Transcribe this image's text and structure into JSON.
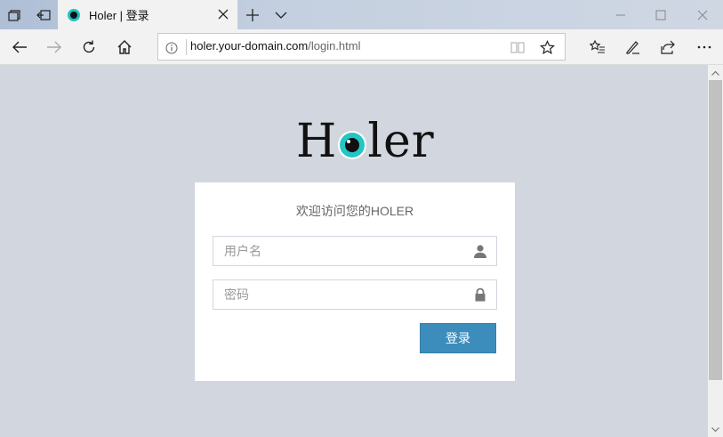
{
  "tab": {
    "title": "Holer | 登录"
  },
  "address": {
    "host": "holer.your-domain.com",
    "path": "/login.html"
  },
  "logo": {
    "left": "H",
    "right": "ler"
  },
  "login": {
    "message": "欢迎访问您的HOLER",
    "username_placeholder": "用户名",
    "password_placeholder": "密码",
    "submit_label": "登录"
  },
  "colors": {
    "background": "#d2d6de",
    "button": "#3c8dbc",
    "logo_accent": "#23c6c2"
  },
  "icons": {
    "tab_actions": "tabs-aside-icon",
    "set_aside": "set-aside-icon",
    "back": "back-arrow-icon",
    "forward": "forward-arrow-icon",
    "refresh": "refresh-icon",
    "home": "home-icon",
    "info": "info-icon",
    "reading_view": "reading-view-icon",
    "favorite": "star-icon",
    "favorites_hub": "favorites-list-icon",
    "notes": "pen-icon",
    "share": "share-icon",
    "more": "more-icon",
    "user": "user-icon",
    "lock": "lock-icon"
  }
}
